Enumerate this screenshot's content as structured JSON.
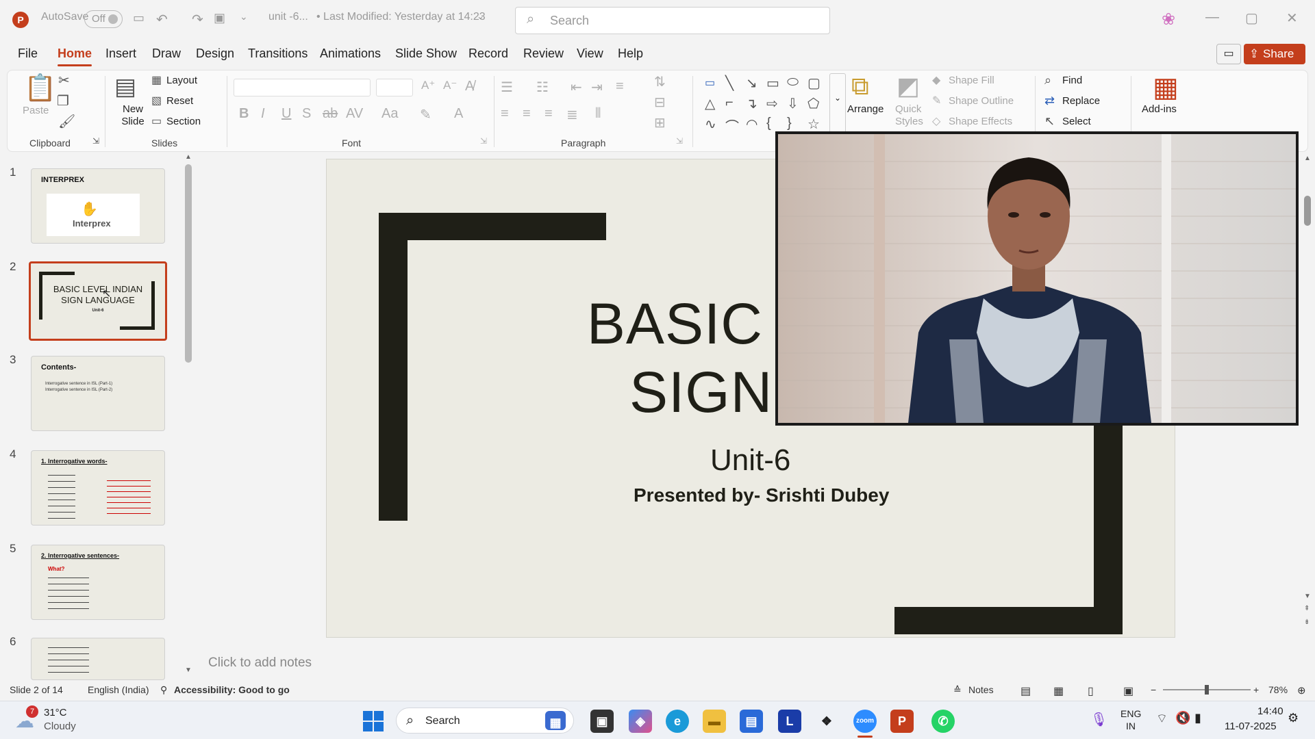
{
  "titlebar": {
    "autosave_label": "AutoSave",
    "autosave_state": "Off",
    "doc_name": "unit -6...",
    "modified": "• Last Modified: Yesterday at 14:23",
    "search_placeholder": "Search"
  },
  "tabs": [
    "File",
    "Home",
    "Insert",
    "Draw",
    "Design",
    "Transitions",
    "Animations",
    "Slide Show",
    "Record",
    "Review",
    "View",
    "Help"
  ],
  "share_label": "Share",
  "ribbon": {
    "clipboard": {
      "paste": "Paste",
      "label": "Clipboard"
    },
    "slides": {
      "new_slide": "New Slide",
      "layout": "Layout",
      "reset": "Reset",
      "section": "Section",
      "label": "Slides"
    },
    "font": {
      "label": "Font"
    },
    "paragraph": {
      "label": "Paragraph"
    },
    "drawing": {
      "arrange": "Arrange",
      "quick_styles": "Quick Styles",
      "shape_fill": "Shape Fill",
      "shape_outline": "Shape Outline",
      "shape_effects": "Shape Effects"
    },
    "editing": {
      "find": "Find",
      "replace": "Replace",
      "select": "Select"
    },
    "addins": "Add-ins"
  },
  "thumbnails": [
    {
      "num": "1",
      "title": "INTERPREX",
      "logo": "Interprex"
    },
    {
      "num": "2",
      "title": "BASIC LEVEL INDIAN SIGN LANGUAGE",
      "sub": "Unit-6"
    },
    {
      "num": "3",
      "title": "Contents-",
      "lines": [
        "Interrogative sentence in ISL (Part-1)",
        "Interrogative sentence in ISL (Part-2)"
      ]
    },
    {
      "num": "4",
      "title": "1. Interrogative words-"
    },
    {
      "num": "5",
      "title": "2. Interrogative sentences-",
      "sub": "What?"
    },
    {
      "num": "6",
      "title": ""
    }
  ],
  "slide": {
    "title_line1": "BASIC LEVE",
    "title_line2": "SIGN LAN",
    "unit": "Unit-6",
    "presenter": "Presented by- Srishti Dubey"
  },
  "notes_placeholder": "Click to add notes",
  "status": {
    "slide_count": "Slide 2 of 14",
    "language": "English (India)",
    "accessibility": "Accessibility: Good to go",
    "notes": "Notes",
    "zoom": "78%",
    "zoom_level": 0.5
  },
  "taskbar": {
    "weather_temp": "31°C",
    "weather_desc": "Cloudy",
    "weather_badge": "7",
    "search": "Search",
    "lang_1": "ENG",
    "lang_2": "IN",
    "time": "14:40",
    "date": "11-07-2025"
  },
  "colors": {
    "accent": "#c43e1c",
    "slide_bg": "#ecebe3",
    "frame": "#1f1f17"
  }
}
